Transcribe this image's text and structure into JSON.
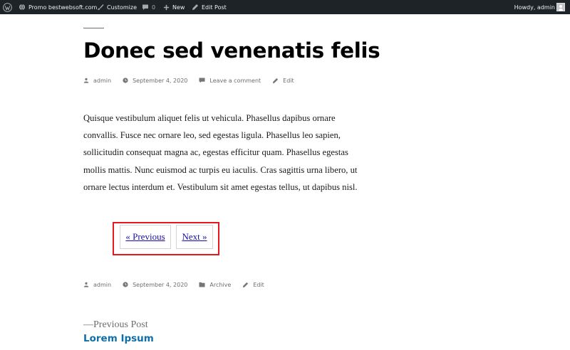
{
  "adminbar": {
    "site_name": "Promo bestwebsoft.com",
    "customize": "Customize",
    "comments_count": "0",
    "new": "New",
    "edit_post": "Edit Post",
    "howdy": "Howdy, admin"
  },
  "post": {
    "title": "Donec sed venenatis felis",
    "meta_top": {
      "author": "admin",
      "date": "September 4, 2020",
      "comment_link": "Leave a comment",
      "edit": "Edit"
    },
    "body": "Quisque vestibulum aliquet felis ut vehicula. Phasellus dapibus ornare convallis. Fusce nec ornare leo, sed egestas ligula. Phasellus leo sapien, sollicitudin consequat magna ac, egestas efficitur quam. Phasellus egestas mollis mattis. Nunc euismod ac turpis eu iaculis. Cras sagittis urna libero, ut ornare lectus interdum et. Vestibulum sit amet egestas tellus, ut dapibus nisl.",
    "meta_bottom": {
      "author": "admin",
      "date": "September 4, 2020",
      "category": "Archive",
      "edit": "Edit"
    }
  },
  "pagination": {
    "previous": "« Previous",
    "next": "Next »",
    "highlight_color": "#e5181b"
  },
  "post_navigation": {
    "label": "—Previous Post",
    "title": "Lorem Ipsum"
  },
  "icons": [
    "wordpress-icon",
    "home-icon",
    "brush-icon",
    "comment-icon",
    "plus-icon",
    "pencil-icon",
    "user-icon",
    "clock-icon",
    "folder-icon",
    "avatar-icon"
  ],
  "colors": {
    "adminbar_bg": "#1d2327",
    "link_blue": "#1a0dab",
    "post_title_link": "#0f6fa8",
    "meta_gray": "#6d6d6d"
  }
}
